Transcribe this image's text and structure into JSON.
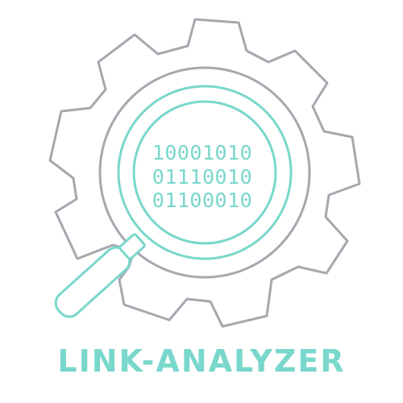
{
  "logo": {
    "brand_name": "LINK-ANALYZER",
    "binary_lines": [
      "10001010",
      "01110010",
      "01100010"
    ],
    "icons": {
      "gear": "gear-icon",
      "magnifier": "magnifying-glass-icon"
    },
    "colors": {
      "teal": "#79d7cb",
      "gray": "#a8a7af",
      "background": "#ffffff"
    }
  }
}
